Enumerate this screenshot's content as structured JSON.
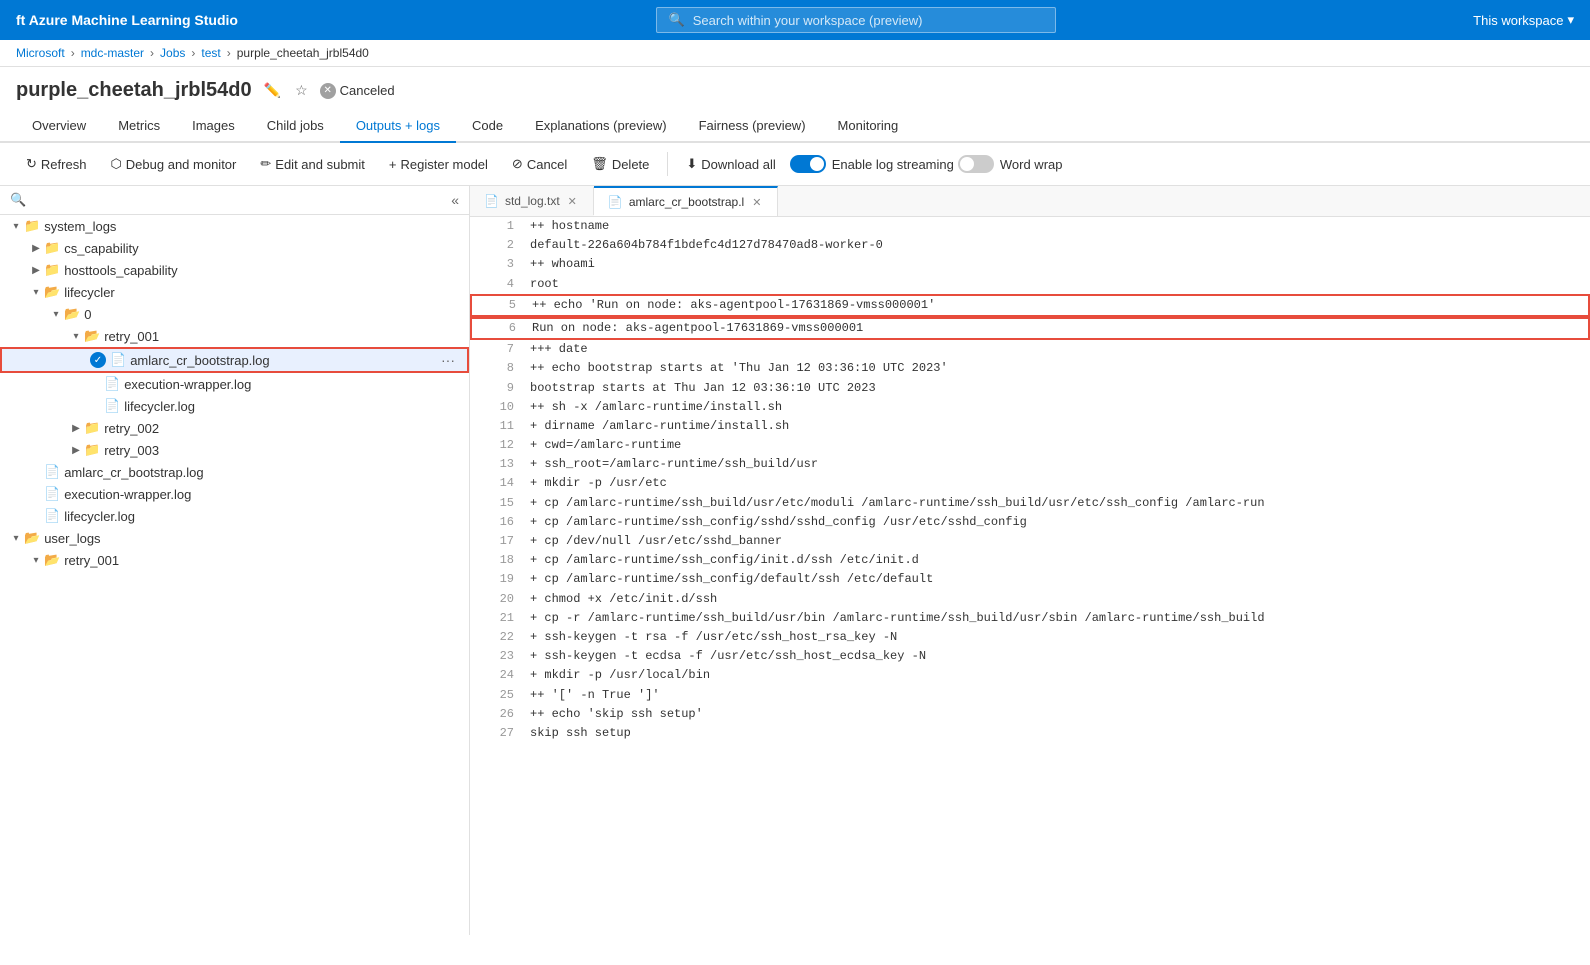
{
  "topbar": {
    "title": "ft Azure Machine Learning Studio",
    "search_placeholder": "Search within your workspace (preview)",
    "workspace_label": "This workspace"
  },
  "breadcrumb": {
    "items": [
      "Microsoft",
      "mdc-master",
      "Jobs",
      "test",
      "purple_cheetah_jrbl54d0"
    ]
  },
  "page": {
    "title": "purple_cheetah_jrbl54d0",
    "status": "Canceled"
  },
  "tabs": [
    {
      "label": "Overview",
      "active": false
    },
    {
      "label": "Metrics",
      "active": false
    },
    {
      "label": "Images",
      "active": false
    },
    {
      "label": "Child jobs",
      "active": false
    },
    {
      "label": "Outputs + logs",
      "active": true
    },
    {
      "label": "Code",
      "active": false
    },
    {
      "label": "Explanations (preview)",
      "active": false
    },
    {
      "label": "Fairness (preview)",
      "active": false
    },
    {
      "label": "Monitoring",
      "active": false
    }
  ],
  "toolbar": {
    "refresh": "Refresh",
    "debug_monitor": "Debug and monitor",
    "edit_submit": "Edit and submit",
    "register_model": "Register model",
    "cancel": "Cancel",
    "delete": "Delete",
    "download_all": "Download all",
    "enable_log_streaming": "Enable log streaming",
    "word_wrap": "Word wrap",
    "log_streaming_on": true,
    "word_wrap_off": false
  },
  "filetree": {
    "items": [
      {
        "type": "folder",
        "name": "system_logs",
        "level": 0,
        "expanded": true,
        "chevron": "▾"
      },
      {
        "type": "folder",
        "name": "cs_capability",
        "level": 1,
        "expanded": false,
        "chevron": "▶"
      },
      {
        "type": "folder",
        "name": "hosttools_capability",
        "level": 1,
        "expanded": false,
        "chevron": "▶"
      },
      {
        "type": "folder",
        "name": "lifecycler",
        "level": 1,
        "expanded": true,
        "chevron": "▾"
      },
      {
        "type": "folder",
        "name": "0",
        "level": 2,
        "expanded": true,
        "chevron": "▾"
      },
      {
        "type": "folder",
        "name": "retry_001",
        "level": 3,
        "expanded": true,
        "chevron": "▾"
      },
      {
        "type": "file",
        "name": "amlarc_cr_bootstrap.log",
        "level": 4,
        "selected": true
      },
      {
        "type": "file",
        "name": "execution-wrapper.log",
        "level": 4
      },
      {
        "type": "file",
        "name": "lifecycler.log",
        "level": 4
      },
      {
        "type": "folder",
        "name": "retry_002",
        "level": 3,
        "expanded": false,
        "chevron": "▶"
      },
      {
        "type": "folder",
        "name": "retry_003",
        "level": 3,
        "expanded": false,
        "chevron": "▶"
      },
      {
        "type": "file",
        "name": "amlarc_cr_bootstrap.log",
        "level": 2
      },
      {
        "type": "file",
        "name": "execution-wrapper.log",
        "level": 2
      },
      {
        "type": "file",
        "name": "lifecycler.log",
        "level": 2
      },
      {
        "type": "folder",
        "name": "user_logs",
        "level": 0,
        "expanded": true,
        "chevron": "▾"
      },
      {
        "type": "folder",
        "name": "retry_001",
        "level": 1,
        "expanded": true,
        "chevron": "▾"
      }
    ]
  },
  "code_tabs": [
    {
      "label": "std_log.txt",
      "active": false,
      "icon": "📄"
    },
    {
      "label": "amlarc_cr_bootstrap.l×",
      "active": true,
      "icon": "📄"
    }
  ],
  "code_lines": [
    {
      "num": 1,
      "content": "++ hostname",
      "highlighted": false
    },
    {
      "num": 2,
      "content": "default-226a604b784f1bdefc4d127d78470ad8-worker-0",
      "highlighted": false
    },
    {
      "num": 3,
      "content": "++ whoami",
      "highlighted": false
    },
    {
      "num": 4,
      "content": "root",
      "highlighted": false
    },
    {
      "num": 5,
      "content": "++ echo 'Run on node: aks-agentpool-17631869-vmss000001'",
      "highlighted": true
    },
    {
      "num": 6,
      "content": "Run on node: aks-agentpool-17631869-vmss000001",
      "highlighted": true
    },
    {
      "num": 7,
      "content": "+++ date",
      "highlighted": false
    },
    {
      "num": 8,
      "content": "++ echo bootstrap starts at 'Thu Jan 12 03:36:10 UTC 2023'",
      "highlighted": false
    },
    {
      "num": 9,
      "content": "bootstrap starts at Thu Jan 12 03:36:10 UTC 2023",
      "highlighted": false
    },
    {
      "num": 10,
      "content": "++ sh -x /amlarc-runtime/install.sh",
      "highlighted": false
    },
    {
      "num": 11,
      "content": "+ dirname /amlarc-runtime/install.sh",
      "highlighted": false
    },
    {
      "num": 12,
      "content": "+ cwd=/amlarc-runtime",
      "highlighted": false
    },
    {
      "num": 13,
      "content": "+ ssh_root=/amlarc-runtime/ssh_build/usr",
      "highlighted": false
    },
    {
      "num": 14,
      "content": "+ mkdir -p /usr/etc",
      "highlighted": false
    },
    {
      "num": 15,
      "content": "+ cp /amlarc-runtime/ssh_build/usr/etc/moduli /amlarc-runtime/ssh_build/usr/etc/ssh_config /amlarc-run",
      "highlighted": false
    },
    {
      "num": 16,
      "content": "+ cp /amlarc-runtime/ssh_config/sshd/sshd_config /usr/etc/sshd_config",
      "highlighted": false
    },
    {
      "num": 17,
      "content": "+ cp /dev/null /usr/etc/sshd_banner",
      "highlighted": false
    },
    {
      "num": 18,
      "content": "+ cp /amlarc-runtime/ssh_config/init.d/ssh /etc/init.d",
      "highlighted": false
    },
    {
      "num": 19,
      "content": "+ cp /amlarc-runtime/ssh_config/default/ssh /etc/default",
      "highlighted": false
    },
    {
      "num": 20,
      "content": "+ chmod +x /etc/init.d/ssh",
      "highlighted": false
    },
    {
      "num": 21,
      "content": "+ cp -r /amlarc-runtime/ssh_build/usr/bin /amlarc-runtime/ssh_build/usr/sbin /amlarc-runtime/ssh_build",
      "highlighted": false
    },
    {
      "num": 22,
      "content": "+ ssh-keygen -t rsa -f /usr/etc/ssh_host_rsa_key -N",
      "highlighted": false
    },
    {
      "num": 23,
      "content": "+ ssh-keygen -t ecdsa -f /usr/etc/ssh_host_ecdsa_key -N",
      "highlighted": false
    },
    {
      "num": 24,
      "content": "+ mkdir -p /usr/local/bin",
      "highlighted": false
    },
    {
      "num": 25,
      "content": "++ '[' -n True ']'",
      "highlighted": false
    },
    {
      "num": 26,
      "content": "++ echo 'skip ssh setup'",
      "highlighted": false
    },
    {
      "num": 27,
      "content": "skip ssh setup",
      "highlighted": false
    }
  ]
}
